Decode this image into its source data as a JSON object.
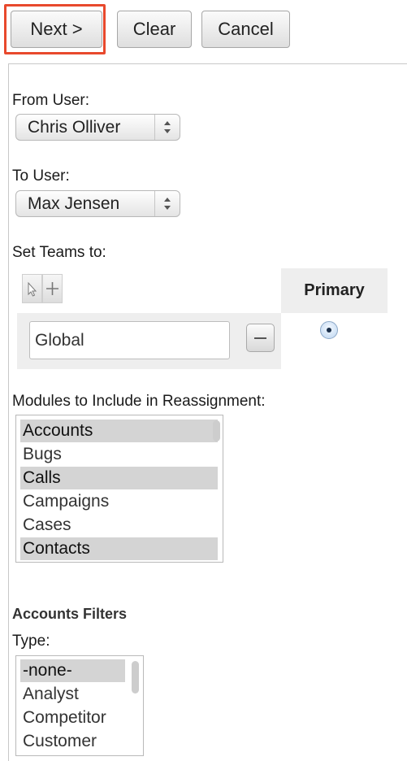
{
  "toolbar": {
    "next_label": "Next >",
    "clear_label": "Clear",
    "cancel_label": "Cancel"
  },
  "from_user": {
    "label": "From User:",
    "value": "Chris Olliver"
  },
  "to_user": {
    "label": "To User:",
    "value": "Max Jensen"
  },
  "teams": {
    "label": "Set Teams to:",
    "primary_header": "Primary",
    "team_name": "Global",
    "primary_selected": true
  },
  "modules": {
    "label": "Modules to Include in Reassignment:",
    "items": [
      {
        "label": "Accounts",
        "selected": true
      },
      {
        "label": "Bugs",
        "selected": false
      },
      {
        "label": "Calls",
        "selected": true
      },
      {
        "label": "Campaigns",
        "selected": false
      },
      {
        "label": "Cases",
        "selected": false
      },
      {
        "label": "Contacts",
        "selected": true
      }
    ]
  },
  "accounts_filters": {
    "heading": "Accounts Filters",
    "type_label": "Type:",
    "type_options": [
      {
        "label": "-none-",
        "selected": true
      },
      {
        "label": "Analyst",
        "selected": false
      },
      {
        "label": "Competitor",
        "selected": false
      },
      {
        "label": "Customer",
        "selected": false
      }
    ]
  },
  "colors": {
    "highlight": "#e8492d",
    "selected_row": "#d4d4d4",
    "primary_header_bg": "#eeeeee"
  }
}
